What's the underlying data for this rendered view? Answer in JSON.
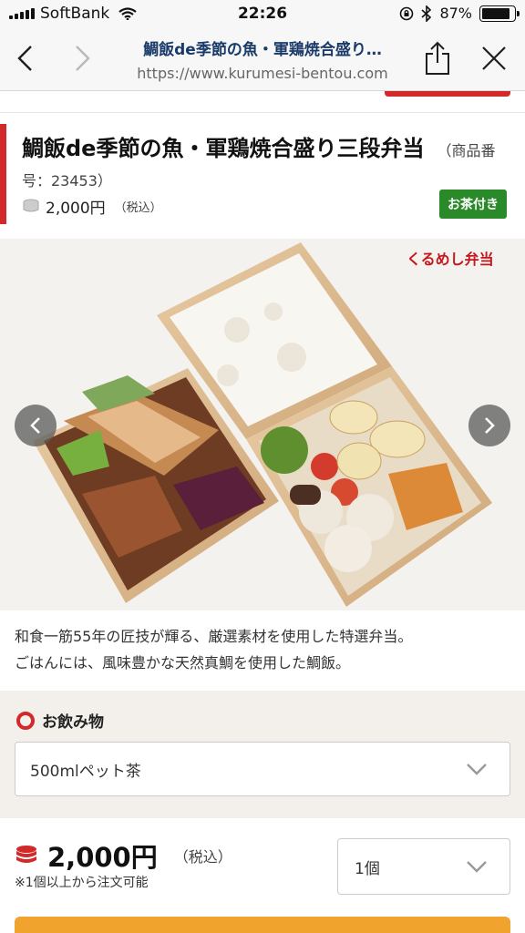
{
  "status_bar": {
    "carrier": "SoftBank",
    "time": "22:26",
    "battery_percent": "87%",
    "battery_level": 0.87
  },
  "browser": {
    "page_title": "鯛飯de季節の魚・軍鶏焼合盛り…",
    "url": "https://www.kurumesi-bentou.com",
    "icons": [
      "back-icon",
      "forward-icon",
      "share-icon",
      "close-icon"
    ]
  },
  "product": {
    "title": "鯛飯de季節の魚・軍鶏焼合盛り三段弁当",
    "code": "（商品番号：23453）",
    "price": "2,000円",
    "tax_note": "（税込）",
    "badge": "お茶付き",
    "image_logo_text": "くるめし弁当",
    "description_lines": [
      "和食一筋55年の匠技が輝る、厳選素材を使用した特選弁当。",
      "ごはんには、風味豊かな天然真鯛を使用した鯛飯。"
    ]
  },
  "options": {
    "drink_label": "お飲み物",
    "drink_selected": "500mlペット茶"
  },
  "order": {
    "price": "2,000円",
    "tax_note": "（税込）",
    "min_note": "※1個以上から注文可能",
    "quantity_selected": "1個"
  },
  "colors": {
    "accent_red": "#d22a2a",
    "badge_green": "#2a8a2a",
    "cart_orange": "#f0a32d",
    "title_navy": "#1a3b6a"
  }
}
